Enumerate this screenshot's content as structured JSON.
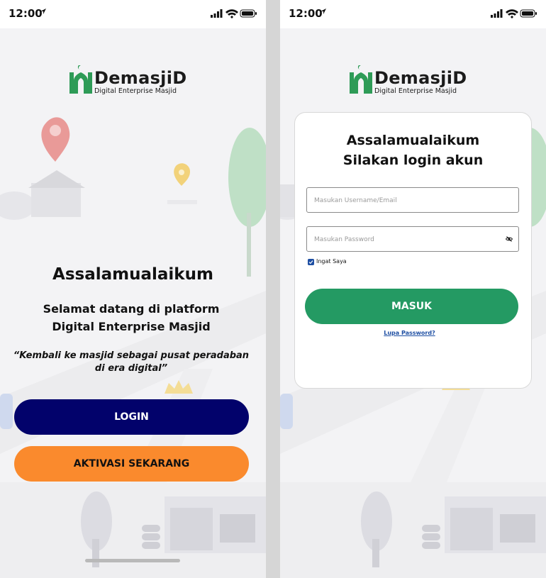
{
  "status_bar": {
    "time": "12:00"
  },
  "brand": {
    "name": "DemasjiD",
    "tagline": "Digital Enterprise Masjid"
  },
  "welcome_screen": {
    "greeting": "Assalamualaikum",
    "welcome_line1": "Selamat datang di platform",
    "welcome_line2": "Digital Enterprise Masjid",
    "quote_line1": "“Kembali ke masjid sebagai pusat peradaban",
    "quote_line2": "di era digital”",
    "login_label": "LOGIN",
    "activate_label": "AKTIVASI SEKARANG"
  },
  "login_screen": {
    "title_line1": "Assalamualaikum",
    "title_line2": "Silakan login akun",
    "username_placeholder": "Masukan Username/Email",
    "password_placeholder": "Masukan Password",
    "remember_label": "Ingat Saya",
    "remember_checked": true,
    "submit_label": "MASUK",
    "forgot_label": "Lupa Password?"
  },
  "colors": {
    "login_button": "#02026b",
    "activate_button": "#fa8a2d",
    "submit_button": "#249a63",
    "brand_green": "#2e9b57",
    "link": "#1e4fa3"
  },
  "icons": [
    "location-arrow-icon",
    "signal-icon",
    "wifi-icon",
    "battery-icon",
    "eye-off-icon",
    "checkbox-icon",
    "logo-mosque-icon"
  ]
}
